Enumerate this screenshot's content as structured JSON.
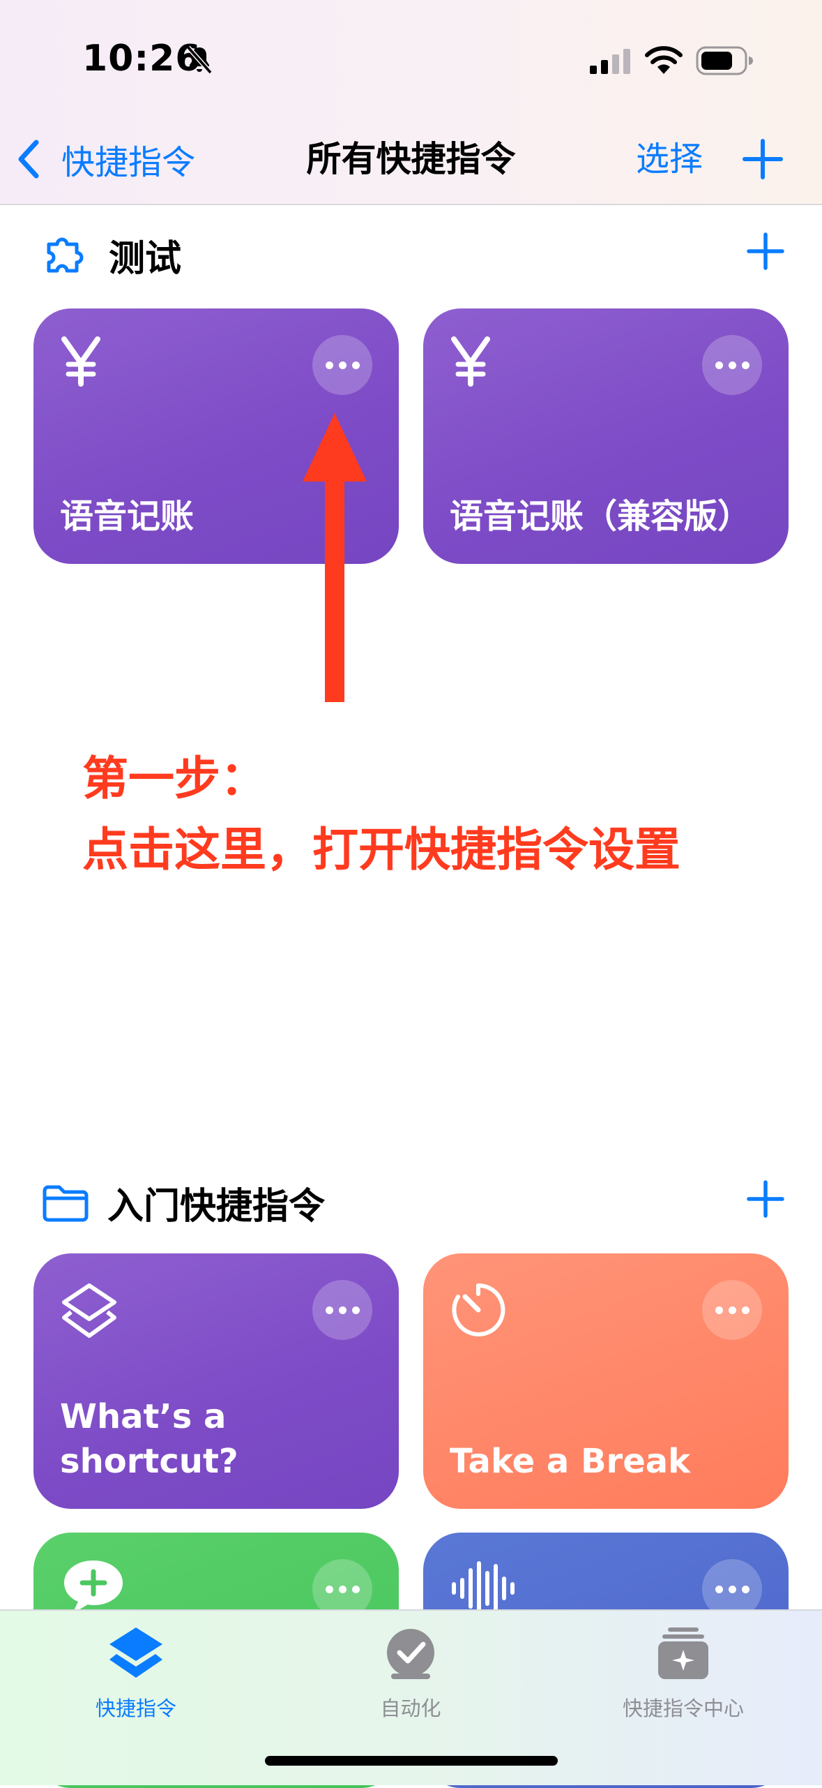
{
  "status_bar": {
    "time": "10:26"
  },
  "nav": {
    "back_label": "快捷指令",
    "title": "所有快捷指令",
    "select_label": "选择"
  },
  "section1": {
    "title": "测试",
    "cards": [
      {
        "label": "语音记账",
        "icon": "yen-icon",
        "color": "#8356ca"
      },
      {
        "label": "语音记账（兼容版）",
        "icon": "yen-icon",
        "color": "#8356ca"
      }
    ]
  },
  "annotation": {
    "line1": "第一步：",
    "line2": "点击这里，打开快捷指令设置",
    "color": "#ff3b1f"
  },
  "section2": {
    "title": "入门快捷指令",
    "cards": [
      {
        "label_line1": "What’s a",
        "label_line2": "shortcut?",
        "icon": "layers-icon",
        "color": "#8356ca"
      },
      {
        "label": "Take a Break",
        "icon": "timer-icon",
        "color": "#ff8566"
      },
      {
        "icon": "message-plus-icon",
        "color": "#4cc760"
      },
      {
        "icon": "waveform-icon",
        "color": "#5068cc"
      }
    ]
  },
  "tab_bar": {
    "tabs": [
      {
        "label": "快捷指令",
        "icon": "shortcuts-icon",
        "active": true
      },
      {
        "label": "自动化",
        "icon": "automation-icon",
        "active": false
      },
      {
        "label": "快捷指令中心",
        "icon": "gallery-icon",
        "active": false
      }
    ]
  },
  "colors": {
    "accent": "#0a7cff",
    "annotation": "#ff3b1f"
  }
}
